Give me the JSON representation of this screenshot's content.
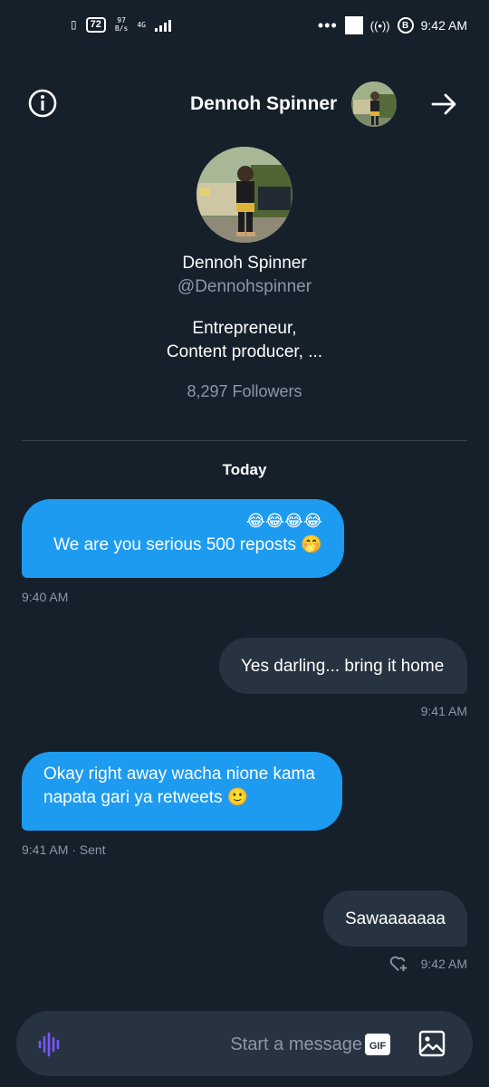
{
  "status_bar": {
    "battery": "72",
    "net_speed_top": "97",
    "net_speed_bottom": "B/s",
    "network_type": "4G",
    "overflow_dots": "•••",
    "b_badge": "B",
    "time": "9:42 AM"
  },
  "header": {
    "title": "Dennoh Spinner",
    "info_icon": "info-icon",
    "arrow_icon": "arrow-right-icon"
  },
  "profile": {
    "name": "Dennoh Spinner",
    "handle": "@Dennohspinner",
    "bio_line1": "Entrepreneur,",
    "bio_line2": "Content producer, ...",
    "followers": "8,297 Followers"
  },
  "date_divider": "Today",
  "messages": [
    {
      "side": "them",
      "line1": "😂😂😂😂",
      "line2": "We  are you serious 500 reposts 🤭",
      "meta": "9:40 AM"
    },
    {
      "side": "me",
      "line1": "Yes darling... bring it home",
      "meta": "9:41 AM"
    },
    {
      "side": "them",
      "line1": "Okay right away wacha nione kama",
      "line2": "napata gari ya retweets 🙂",
      "meta": "9:41 AM · Sent"
    },
    {
      "side": "me",
      "line1": "Sawaaaaaaa",
      "meta": "9:42 AM",
      "reaction_icon": "heart-plus-icon"
    }
  ],
  "composer": {
    "placeholder": "Start a message",
    "gif_label": "GIF",
    "voice_icon": "voice-wave-icon",
    "image_icon": "image-icon"
  },
  "colors": {
    "background": "#15202b",
    "bubble_them": "#1d9bf0",
    "bubble_me": "#273340",
    "muted_text": "#8b98a5",
    "voice_accent": "#7856ff"
  }
}
